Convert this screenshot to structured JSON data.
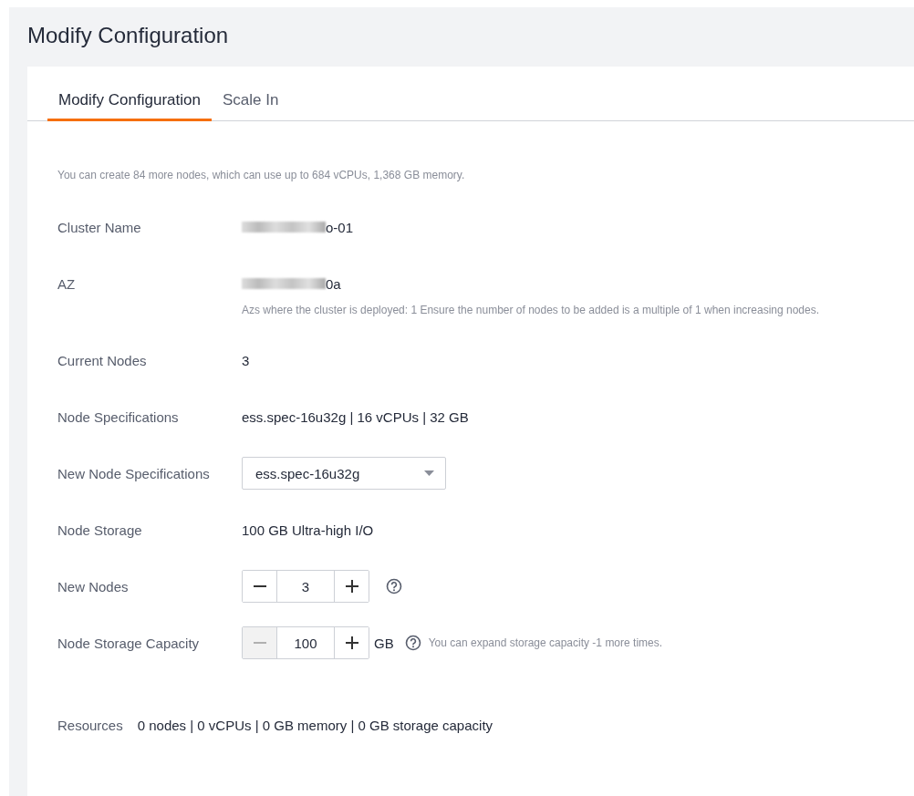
{
  "page_title": "Modify Configuration",
  "tabs": [
    {
      "label": "Modify Configuration",
      "selected": true
    },
    {
      "label": "Scale In",
      "selected": false
    }
  ],
  "info": "You can create 84 more nodes, which can use up to 684 vCPUs, 1,368 GB memory.",
  "fields": [
    {
      "kind": "text",
      "label": "Cluster Name",
      "value": "o-01",
      "redacted": true
    },
    {
      "kind": "text",
      "label": "AZ",
      "value": "0a",
      "redacted": true,
      "hint": "Azs where the cluster is deployed: 1 Ensure the number of nodes to be added is a multiple of 1 when increasing nodes."
    },
    {
      "kind": "text",
      "label": "Current Nodes",
      "value": "3",
      "redacted": false
    },
    {
      "kind": "text",
      "label": "Node Specifications",
      "value": "ess.spec-16u32g | 16 vCPUs | 32 GB",
      "redacted": false
    },
    {
      "kind": "select",
      "label": "New Node Specifications",
      "value": "ess.spec-16u32g"
    },
    {
      "kind": "text",
      "label": "Node Storage",
      "value": "100 GB Ultra-high I/O",
      "redacted": false
    },
    {
      "kind": "stepper",
      "label": "New Nodes",
      "value": "3",
      "minus_disabled": false,
      "plus_disabled": false
    },
    {
      "kind": "stepper",
      "label": "Node Storage Capacity",
      "value": "100",
      "unit": "GB",
      "minus_disabled": true,
      "plus_disabled": false,
      "note": "You can expand storage capacity -1 more times."
    }
  ],
  "resources": {
    "label": "Resources",
    "value": "0 nodes | 0 vCPUs | 0 GB memory | 0 GB storage capacity"
  }
}
